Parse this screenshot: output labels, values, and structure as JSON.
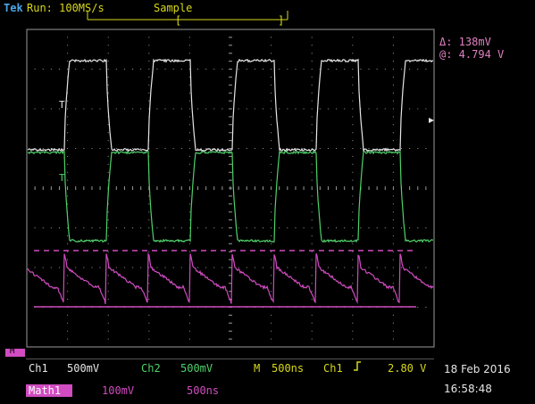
{
  "header": {
    "brand": "Tek",
    "status": "Run: 100MS/s",
    "mode": "Sample",
    "record_bracket_left": "[",
    "record_bracket_right": "]"
  },
  "cursor_readout": {
    "delta": "Δ: 138mV",
    "at": "@: 4.794 V"
  },
  "channel_markers": {
    "ch1": "T",
    "ch2": "T",
    "math": "M"
  },
  "footer": {
    "ch1_label": "Ch1",
    "ch1_scale": "500mV",
    "ch2_label": "Ch2",
    "ch2_scale": "500mV",
    "timebase_label": "M",
    "timebase": "500ns",
    "trigger_source": "Ch1",
    "trigger_slope_icon": "rising-edge-icon",
    "trigger_level": "2.80 V",
    "date": "18 Feb 2016",
    "time": "16:58:48",
    "math_label": "Math1",
    "math_scale": "100mV",
    "math_timebase": "500ns"
  },
  "colors": {
    "ch1": "#e6e6e6",
    "ch2": "#4fd16a",
    "math": "#d04cc0",
    "ui_yellow": "#d8d81a",
    "cursor_pink": "#e080c0",
    "grid": "#9a9a9a"
  }
}
